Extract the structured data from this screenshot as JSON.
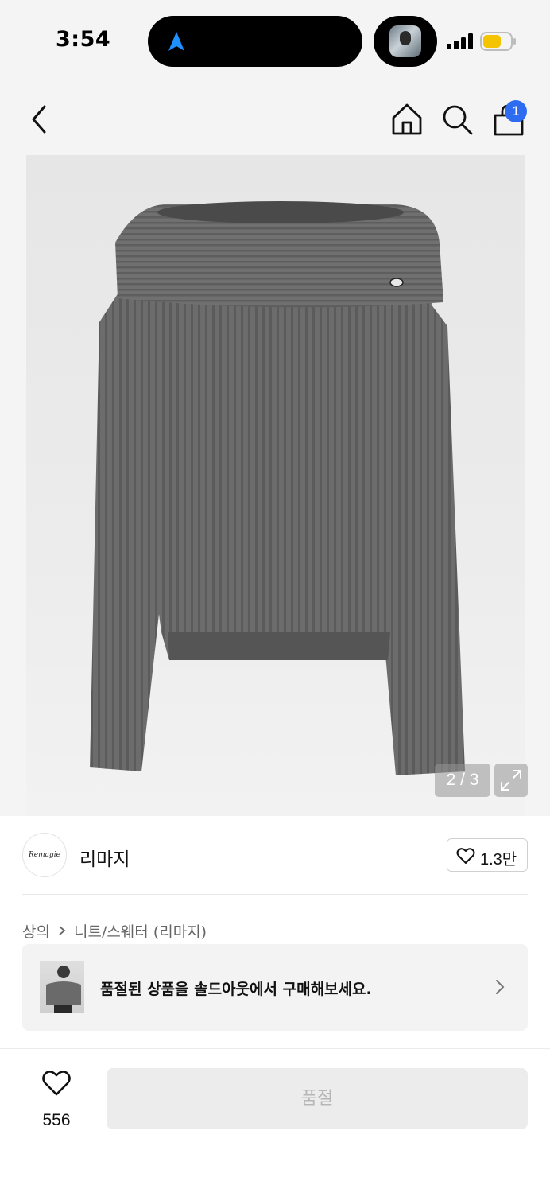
{
  "status_bar": {
    "time": "3:54"
  },
  "header": {
    "cart_badge": "1"
  },
  "product_image": {
    "page_indicator": "2 / 3"
  },
  "brand": {
    "logo_text": "Remagie",
    "name": "리마지",
    "like_count": "1.3만"
  },
  "breadcrumb": {
    "category": "상의",
    "subcategory": "니트/스웨터 (리마지)"
  },
  "soldout_banner": {
    "text": "품절된 상품을 솔드아웃에서 구매해보세요."
  },
  "bottom_bar": {
    "like_count": "556",
    "buy_label": "품절"
  },
  "colors": {
    "accent_badge": "#2d6cf0",
    "island_nav_arrow": "#1e90ff",
    "battery": "#f5c400"
  }
}
